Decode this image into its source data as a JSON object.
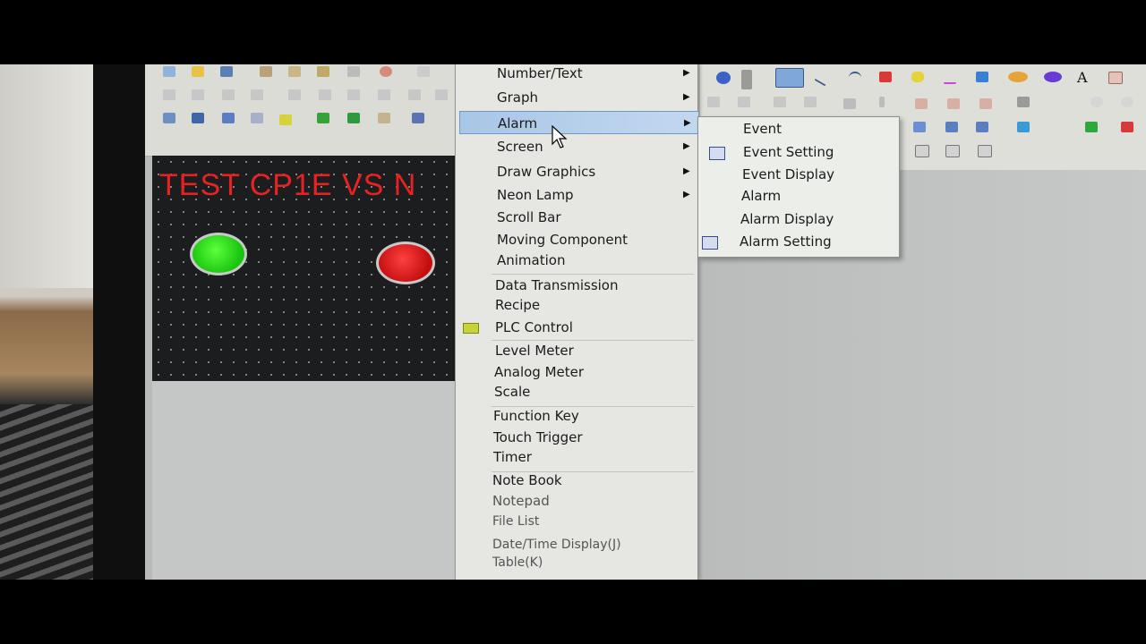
{
  "canvas": {
    "title": "TEST CP1E VS N"
  },
  "menu": {
    "items": [
      {
        "label": "Number/Text",
        "submenu": true
      },
      {
        "label": "Graph",
        "submenu": true
      },
      {
        "label": "Alarm",
        "submenu": true,
        "highlighted": true
      },
      {
        "label": "Screen",
        "submenu": true
      },
      {
        "label": "Draw Graphics",
        "submenu": true
      },
      {
        "label": "Neon Lamp",
        "submenu": true
      },
      {
        "label": "Scroll Bar"
      },
      {
        "label": "Moving Component"
      },
      {
        "label": "Animation"
      },
      {
        "label": "Data Transmission"
      },
      {
        "label": "Recipe"
      },
      {
        "label": "PLC Control"
      },
      {
        "label": "Level Meter"
      },
      {
        "label": "Analog Meter"
      },
      {
        "label": "Scale"
      },
      {
        "label": "Function Key"
      },
      {
        "label": "Touch Trigger"
      },
      {
        "label": "Timer"
      },
      {
        "label": "Note Book"
      },
      {
        "label": "Notepad"
      },
      {
        "label": "File List"
      },
      {
        "label": "Date/Time Display(J)"
      },
      {
        "label": "Table(K)"
      }
    ]
  },
  "submenu": {
    "items": [
      {
        "label": "Event"
      },
      {
        "label": "Event Setting"
      },
      {
        "label": "Event Display"
      },
      {
        "label": "Alarm"
      },
      {
        "label": "Alarm Display"
      },
      {
        "label": "Alarm Setting"
      }
    ]
  },
  "colors": {
    "canvas_title": "#e62222",
    "lamp_green": "#18c40e",
    "lamp_red": "#c40e0e",
    "highlight": "#a9c6e6"
  },
  "icons": [
    "pointer-tool-icon",
    "line-tool-icon",
    "rectangle-tool-icon",
    "ellipse-tool-icon",
    "polygon-tool-icon",
    "text-tool-icon",
    "help-icon",
    "save-icon",
    "open-folder-icon"
  ]
}
